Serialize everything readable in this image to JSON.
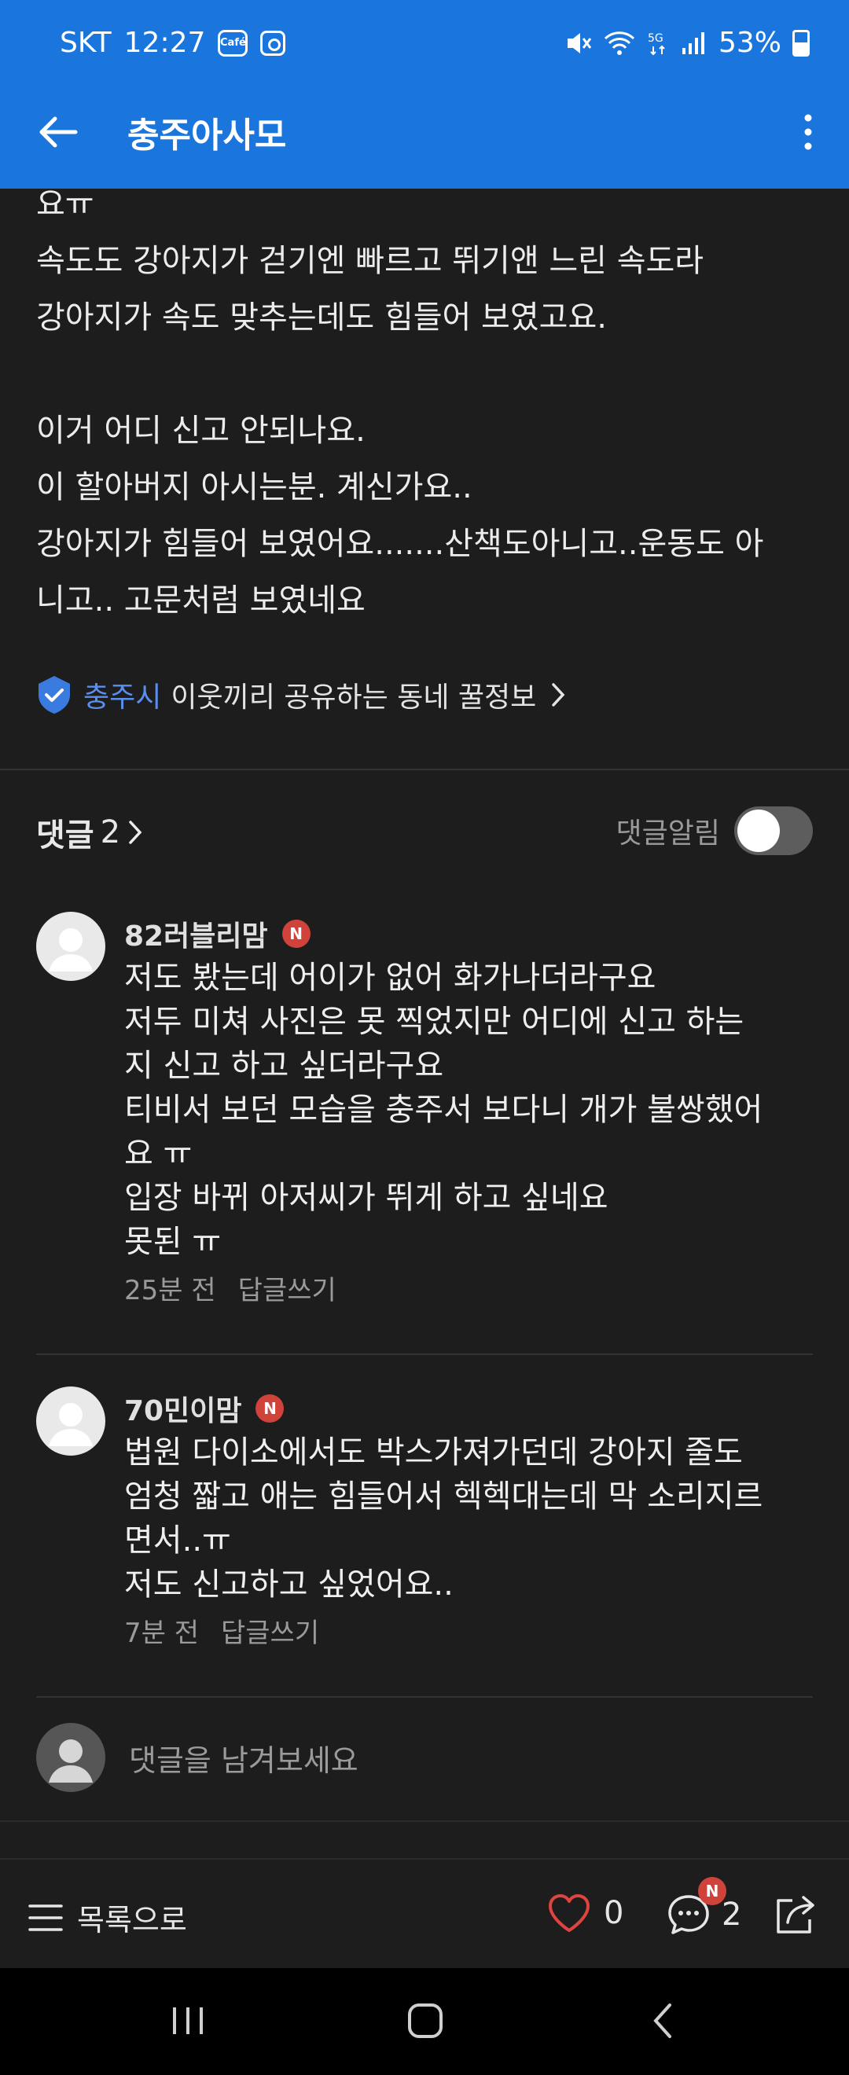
{
  "status_bar": {
    "carrier": "SKT",
    "time": "12:27",
    "cafe_badge": "Café",
    "battery": "53%",
    "icons": [
      "mute-icon",
      "wifi-icon",
      "5g-icon",
      "signal-icon",
      "battery-icon"
    ]
  },
  "appbar": {
    "title": "충주아사모"
  },
  "post": {
    "lines": [
      "요ㅠ",
      "속도도 강아지가 걷기엔 빠르고 뛰기앤 느린 속도라",
      "강아지가 속도 맞추는데도 힘들어 보였고요.",
      "",
      "이거 어디 신고 안되나요.",
      "이 할아버지 아시는분. 계신가요..",
      "강아지가 힘들어 보였어요.......산책도아니고..운동도 아",
      "니고.. 고문처럼 보였네요"
    ]
  },
  "cafe_link": {
    "city": "충주시",
    "description": "이웃끼리 공유하는 동네 꿀정보"
  },
  "comments_header": {
    "label": "댓글",
    "count": "2",
    "notify_label": "댓글알림",
    "notify_on": false
  },
  "comments": [
    {
      "nickname": "82러블리맘",
      "badge": "N",
      "lines": [
        "저도 봤는데 어이가 없어 화가나더라구요",
        "저두 미쳐 사진은 못 찍었지만 어디에 신고 하는",
        "지 신고 하고 싶더라구요",
        "티비서 보던 모습을 충주서 보다니 개가 불쌍했어",
        "요 ㅠ",
        "입장 바뀌 아저씨가 뛰게 하고 싶네요",
        "못된 ㅠ"
      ],
      "time": "25분 전",
      "reply": "답글쓰기"
    },
    {
      "nickname": "70민이맘",
      "badge": "N",
      "lines": [
        "법원 다이소에서도 박스가져가던데 강아지 줄도",
        "엄청 짧고 애는 힘들어서 헥헥대는데 막 소리지르",
        "면서..ㅠ",
        "저도 신고하고 싶었어요.."
      ],
      "time": "7분 전",
      "reply": "답글쓰기"
    }
  ],
  "write_comment": {
    "placeholder": "댓글을 남겨보세요"
  },
  "bottom_bar": {
    "list_label": "목록으로",
    "like_count": "0",
    "comment_count": "2",
    "comment_badge": "N"
  }
}
